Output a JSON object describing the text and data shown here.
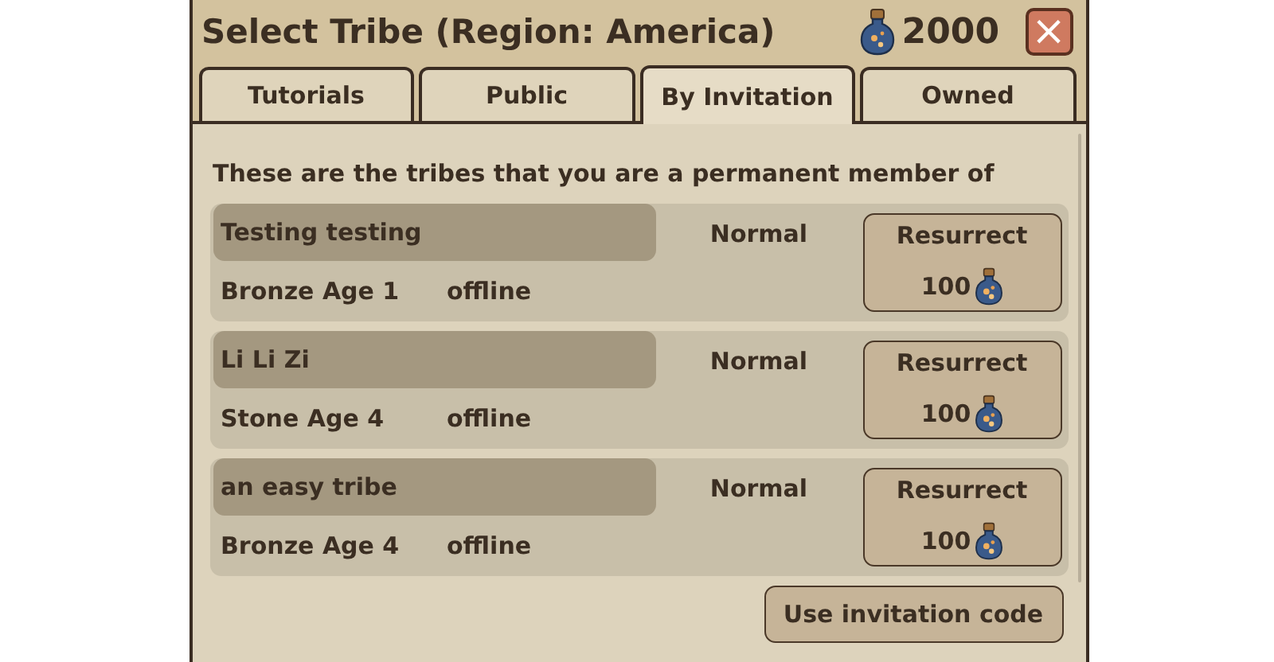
{
  "window": {
    "title": "Select Tribe (Region: America)",
    "currency": "2000",
    "close": "×"
  },
  "tabs": [
    {
      "label": "Tutorials",
      "selected": false
    },
    {
      "label": "Public",
      "selected": false
    },
    {
      "label": "By Invitation",
      "selected": true
    },
    {
      "label": "Owned",
      "selected": false
    }
  ],
  "intro": "These are the tribes that you are a permanent member of",
  "tribes": [
    {
      "name": "Testing testing",
      "mode": "Normal",
      "age": "Bronze Age 1",
      "status": "offline",
      "action": "Resurrect",
      "cost": "100"
    },
    {
      "name": "Li Li Zi",
      "mode": "Normal",
      "age": "Stone Age 4",
      "status": "offline",
      "action": "Resurrect",
      "cost": "100"
    },
    {
      "name": "an easy tribe",
      "mode": "Normal",
      "age": "Bronze Age 4",
      "status": "offline",
      "action": "Resurrect",
      "cost": "100"
    }
  ],
  "footer_button": "Use invitation code"
}
